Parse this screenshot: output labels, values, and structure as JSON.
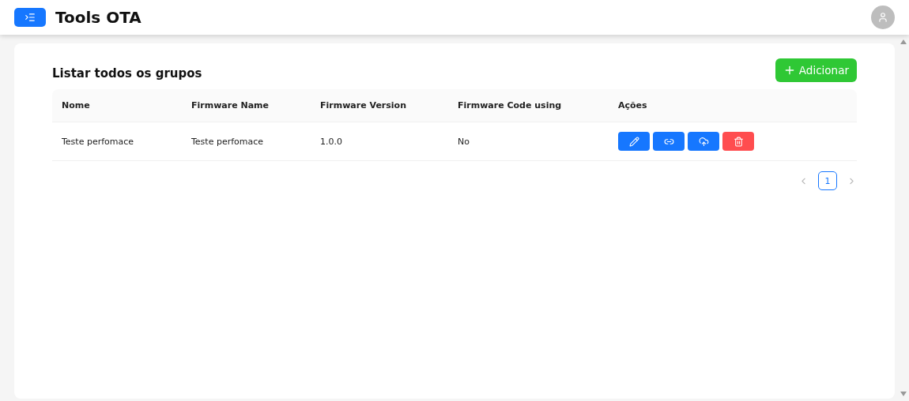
{
  "header": {
    "title": "Tools OTA"
  },
  "card": {
    "title": "Listar todos os grupos",
    "add_button": "Adicionar"
  },
  "table": {
    "columns": [
      "Nome",
      "Firmware Name",
      "Firmware Version",
      "Firmware Code using",
      "Ações"
    ],
    "rows": [
      {
        "cells": [
          "Teste perfomace",
          "Teste perfomace",
          "1.0.0",
          "No"
        ],
        "actions": [
          {
            "kind": "edit"
          },
          {
            "kind": "link"
          },
          {
            "kind": "upload"
          },
          {
            "kind": "delete"
          }
        ]
      }
    ]
  },
  "pagination": {
    "pages": [
      {
        "label": "1",
        "selected": true
      }
    ]
  }
}
